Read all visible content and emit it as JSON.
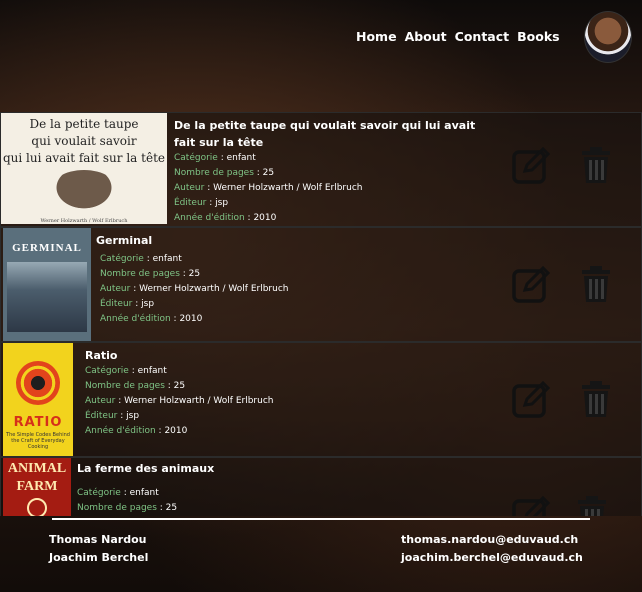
{
  "nav": {
    "links": [
      {
        "label": "Home"
      },
      {
        "label": "About"
      },
      {
        "label": "Contact"
      },
      {
        "label": "Books"
      }
    ]
  },
  "labels": {
    "category": "Catégorie",
    "pages": "Nombre de pages",
    "author": "Auteur",
    "publisher": "Éditeur",
    "year": "Année d'édition",
    "sep": " : "
  },
  "books": [
    {
      "title": "De la petite taupe qui voulait savoir qui lui avait fait sur la tête",
      "category": "enfant",
      "pages": "25",
      "author": "Werner Holzwarth / Wolf Erlbruch",
      "publisher": "jsp",
      "year": "2010",
      "cover": {
        "line1": "De la petite taupe",
        "line2": "qui voulait savoir",
        "line3": "qui lui avait fait sur la tête",
        "credit": "Werner Holzwarth / Wolf Erlbruch"
      }
    },
    {
      "title": "Germinal",
      "category": "enfant",
      "pages": "25",
      "author": "Werner Holzwarth / Wolf Erlbruch",
      "publisher": "jsp",
      "year": "2010",
      "cover": {
        "line1": "GERMINAL"
      }
    },
    {
      "title": "Ratio",
      "category": "enfant",
      "pages": "25",
      "author": "Werner Holzwarth / Wolf Erlbruch",
      "publisher": "jsp",
      "year": "2010",
      "cover": {
        "line1": "RATIO",
        "sub": "The Simple Codes Behind the Craft of Everyday Cooking"
      }
    },
    {
      "title": "La ferme des animaux",
      "category": "enfant",
      "pages": "25",
      "cover": {
        "line1": "ANIMAL",
        "line2": "FARM"
      }
    }
  ],
  "footer": {
    "names": [
      "Thomas Nardou",
      "Joachim Berchel"
    ],
    "emails": [
      "thomas.nardou@eduvaud.ch",
      "joachim.berchel@eduvaud.ch"
    ]
  }
}
